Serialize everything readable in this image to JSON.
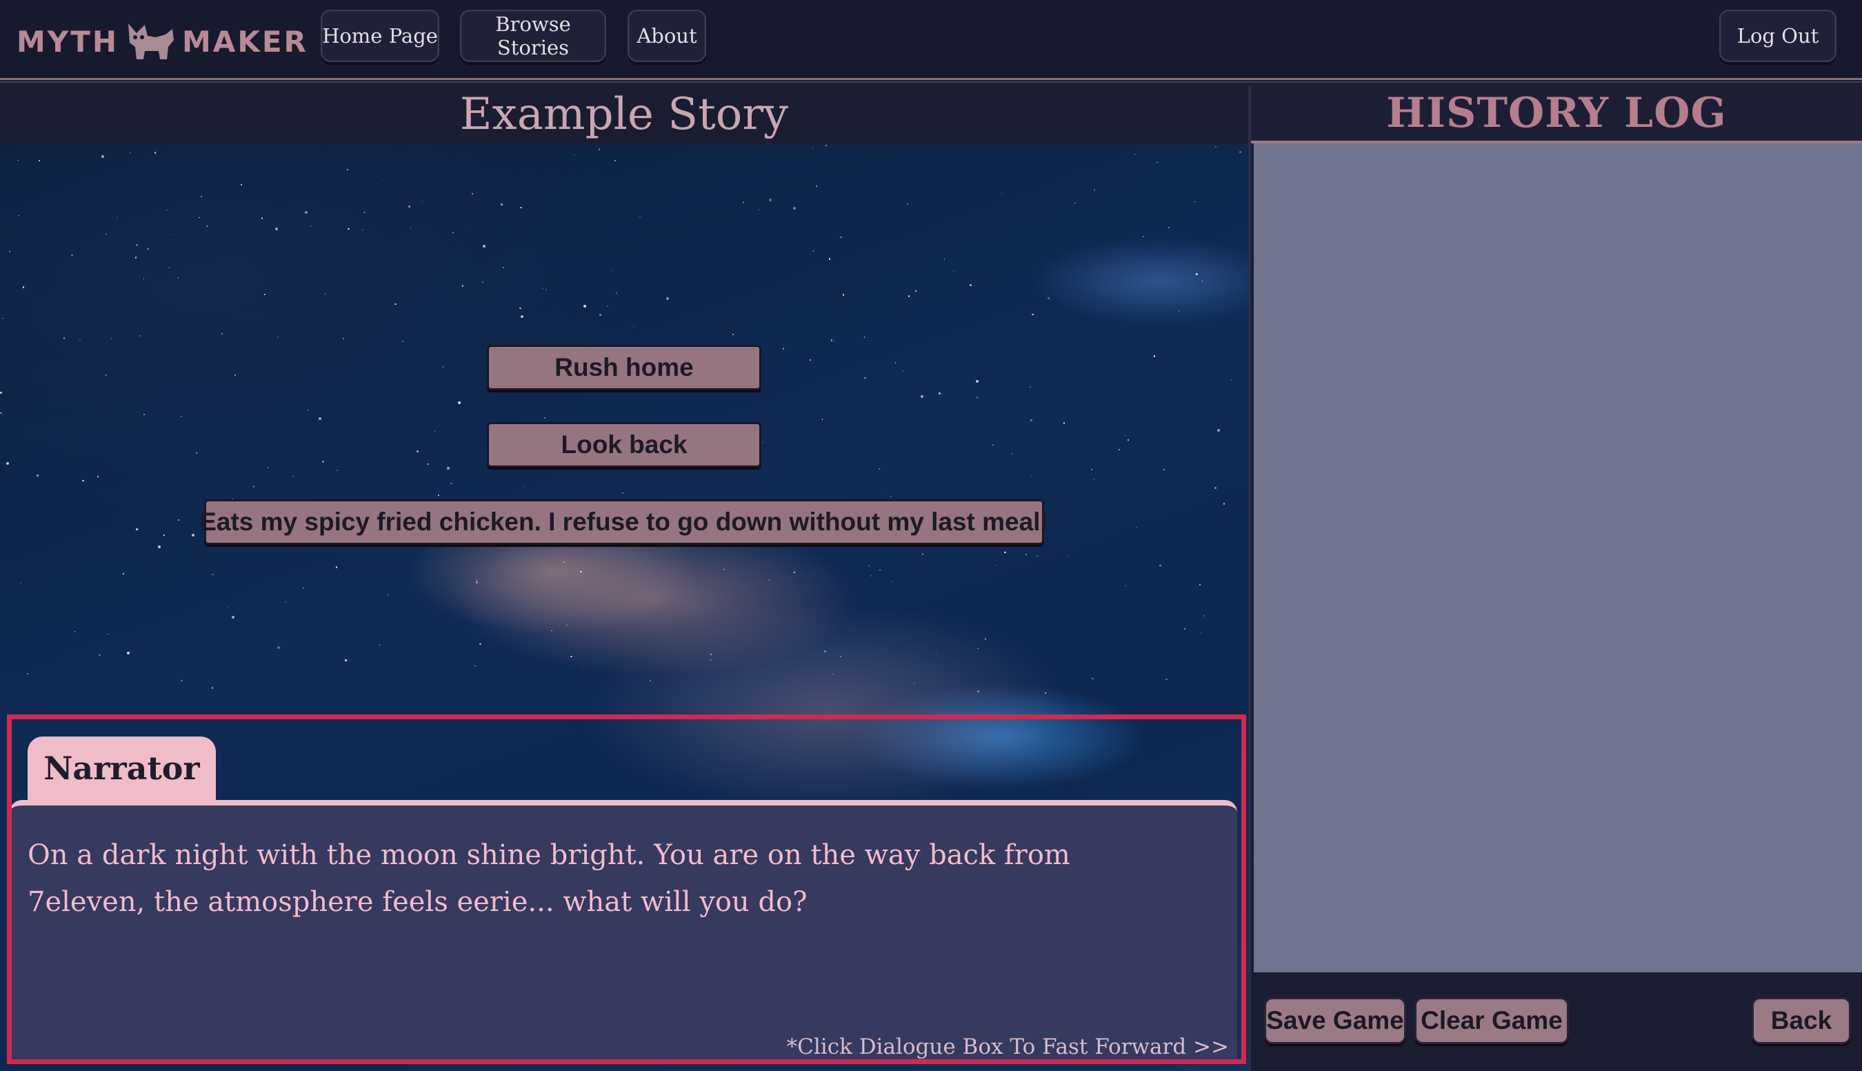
{
  "app": {
    "logo_left": "MYTH",
    "logo_right": "MAKER"
  },
  "nav": {
    "home": "Home Page",
    "browse": "Browse Stories",
    "about": "About",
    "logout": "Log Out"
  },
  "story": {
    "title": "Example Story",
    "choices": [
      "Rush home",
      "Look back",
      "Eats my spicy fried chicken. I refuse to go down without my last meal!"
    ]
  },
  "dialogue": {
    "speaker": "Narrator",
    "text": "On a dark night with the moon shine bright. You are on the way back from 7eleven, the atmosphere feels eerie... what will you do?",
    "hint": "*Click Dialogue Box To Fast Forward >>"
  },
  "history": {
    "title": "HISTORY LOG",
    "save": "Save Game",
    "clear": "Clear Game",
    "back": "Back"
  },
  "colors": {
    "accent_pink": "#f0bcc8",
    "highlight_red": "#d12a52",
    "button_mauve": "#947580"
  }
}
